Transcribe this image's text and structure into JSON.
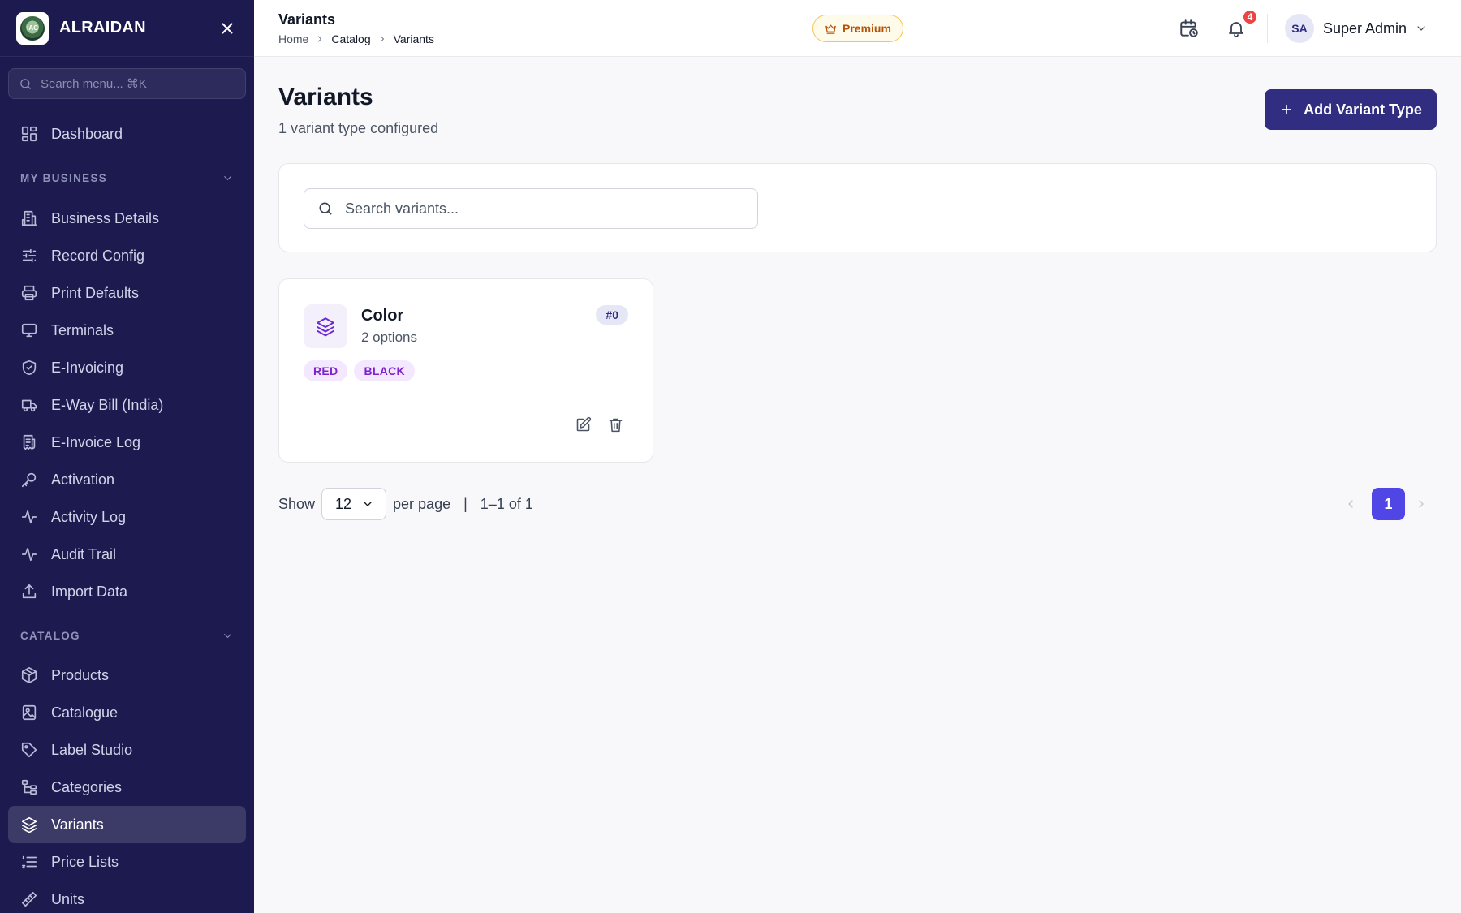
{
  "brand": {
    "name": "ALRAIDAN",
    "logo_text": "IAC"
  },
  "sidebar": {
    "search_placeholder": "Search menu... ⌘K",
    "top_items": [
      {
        "label": "Dashboard",
        "icon": "dashboard-icon"
      }
    ],
    "sections": [
      {
        "title": "MY BUSINESS",
        "items": [
          {
            "label": "Business Details",
            "icon": "building-icon"
          },
          {
            "label": "Record Config",
            "icon": "sliders-icon"
          },
          {
            "label": "Print Defaults",
            "icon": "printer-icon"
          },
          {
            "label": "Terminals",
            "icon": "monitor-icon"
          },
          {
            "label": "E-Invoicing",
            "icon": "shield-check-icon"
          },
          {
            "label": "E-Way Bill (India)",
            "icon": "truck-icon"
          },
          {
            "label": "E-Invoice Log",
            "icon": "receipt-icon"
          },
          {
            "label": "Activation",
            "icon": "key-icon"
          },
          {
            "label": "Activity Log",
            "icon": "activity-icon"
          },
          {
            "label": "Audit Trail",
            "icon": "activity-icon"
          },
          {
            "label": "Import Data",
            "icon": "upload-icon"
          }
        ]
      },
      {
        "title": "CATALOG",
        "items": [
          {
            "label": "Products",
            "icon": "package-icon"
          },
          {
            "label": "Catalogue",
            "icon": "image-icon"
          },
          {
            "label": "Label Studio",
            "icon": "tag-icon"
          },
          {
            "label": "Categories",
            "icon": "tree-icon"
          },
          {
            "label": "Variants",
            "icon": "layers-icon",
            "active": true
          },
          {
            "label": "Price Lists",
            "icon": "list-icon"
          },
          {
            "label": "Units",
            "icon": "ruler-icon"
          }
        ]
      }
    ]
  },
  "header": {
    "title": "Variants",
    "breadcrumb": [
      "Home",
      "Catalog",
      "Variants"
    ],
    "premium_label": "Premium",
    "notification_count": "4",
    "user_initials": "SA",
    "user_name": "Super Admin"
  },
  "main": {
    "title": "Variants",
    "subtitle": "1 variant type configured",
    "add_button": "Add Variant Type",
    "search_placeholder": "Search variants...",
    "variants": [
      {
        "name": "Color",
        "options_count": "2 options",
        "id_badge": "#0",
        "options": [
          "RED",
          "BLACK"
        ]
      }
    ],
    "pagination": {
      "show_label": "Show",
      "per_page_value": "12",
      "per_page_label": "per page",
      "separator": "|",
      "range": "1–1 of 1",
      "current_page": "1"
    }
  },
  "colors": {
    "sidebar_bg": "#1c1a4e",
    "primary": "#312e81",
    "active_page": "#4f46e5",
    "tag_bg": "#f3e8ff",
    "tag_text": "#7e22ce",
    "premium_border": "#f6c453"
  }
}
